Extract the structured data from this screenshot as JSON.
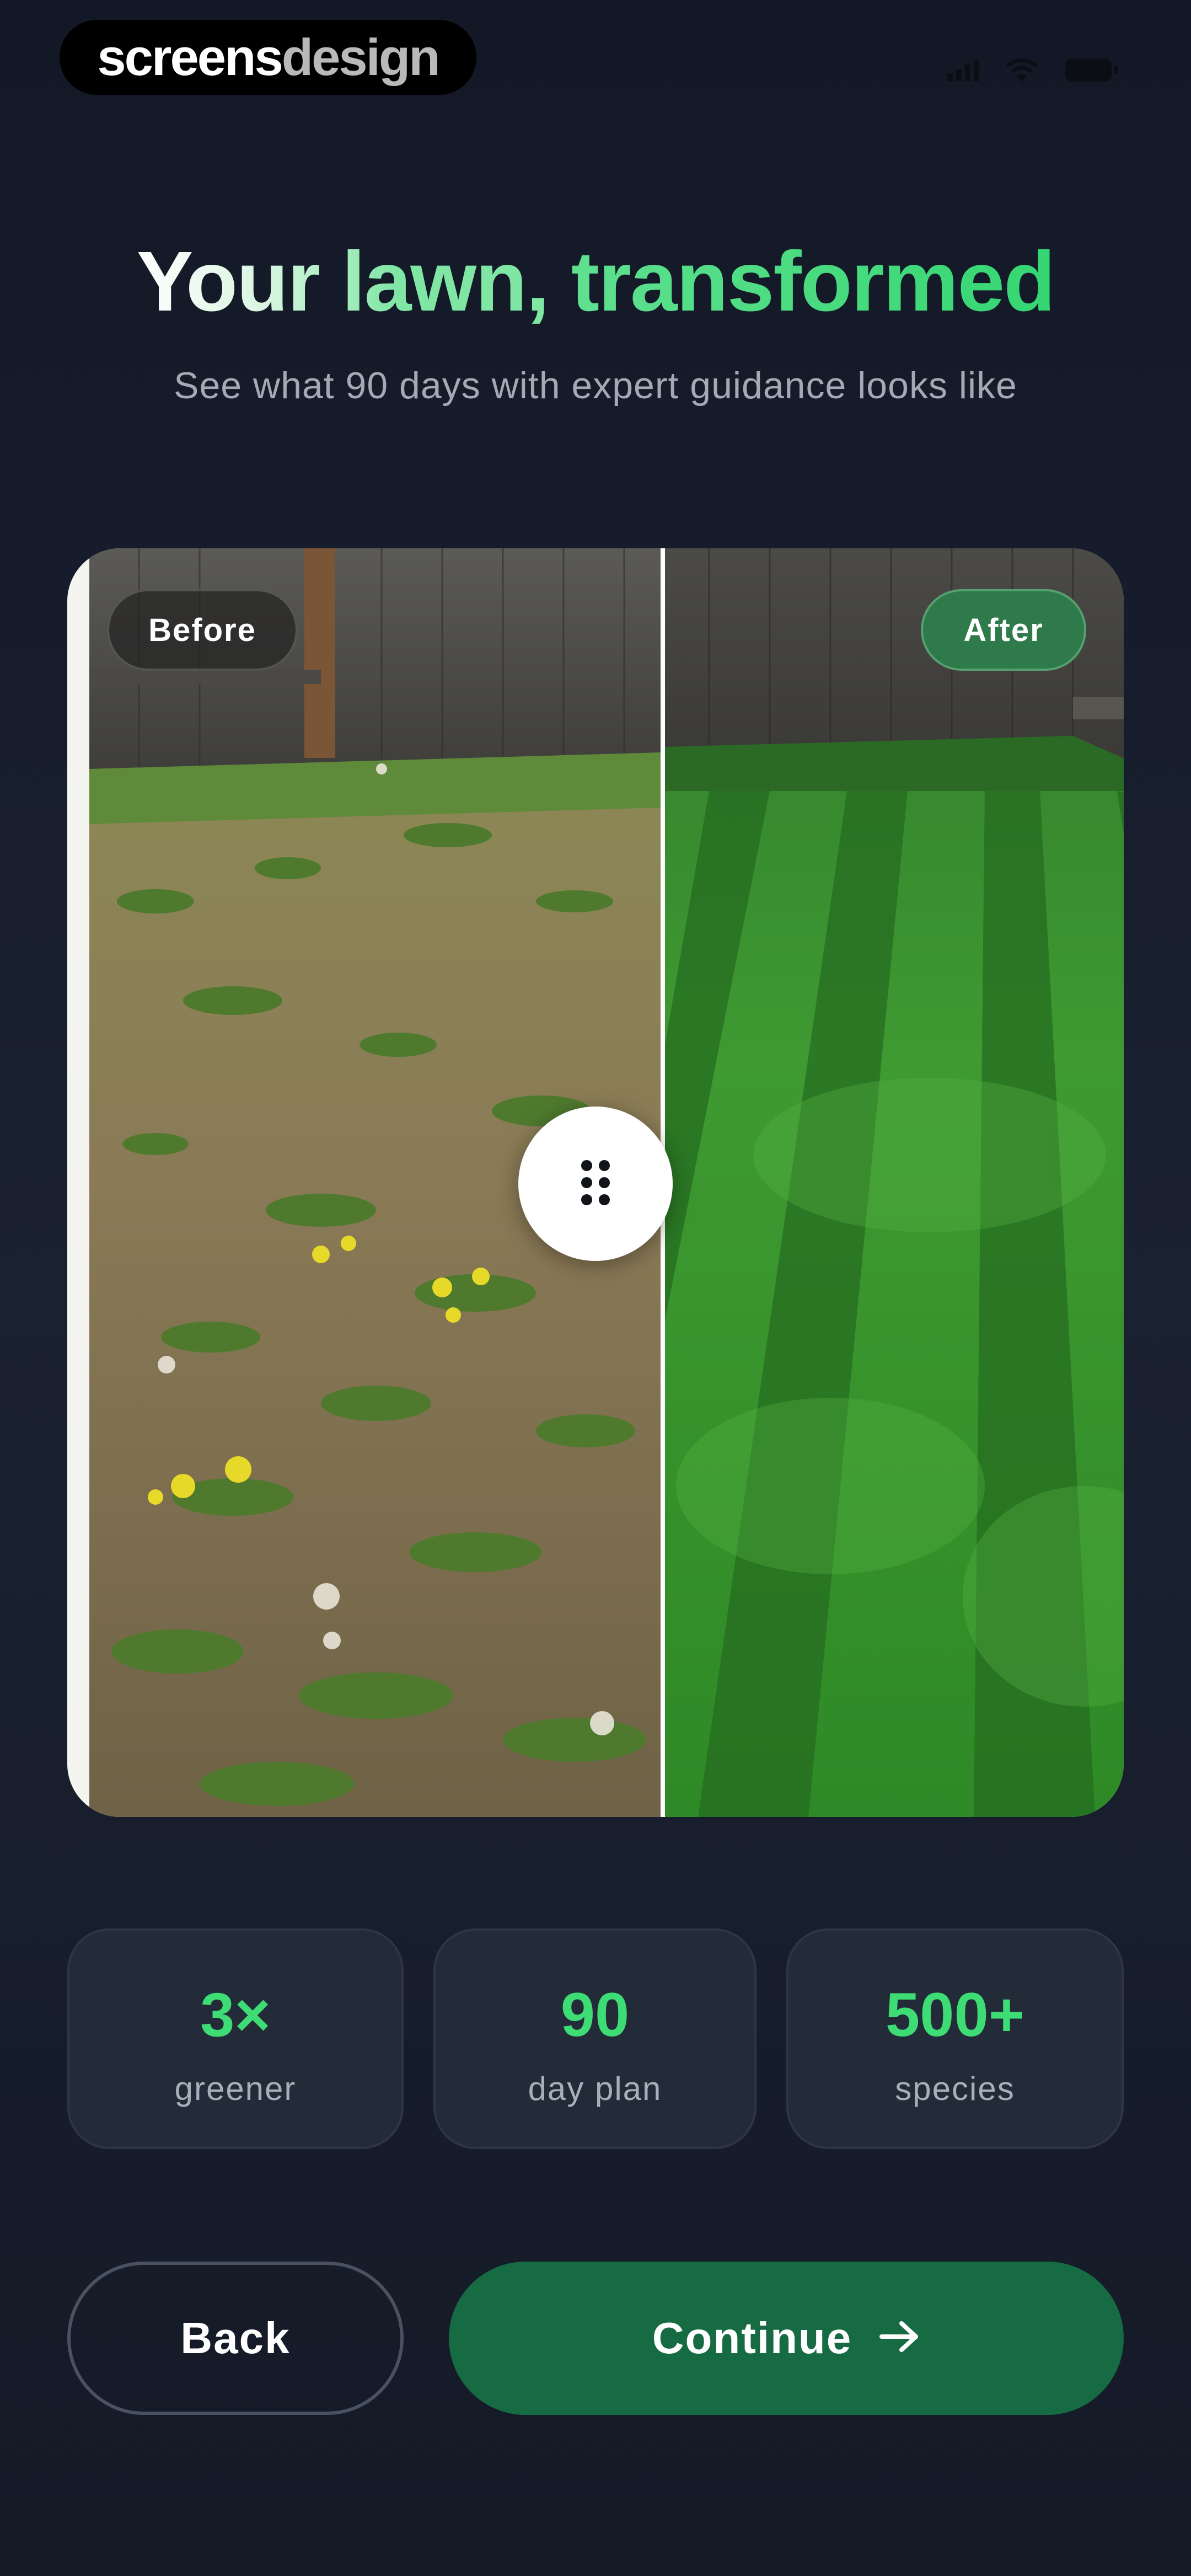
{
  "brand": {
    "part1": "screens",
    "part2": "design"
  },
  "heading": {
    "title_white": "Your lawn, ",
    "title_green": "transformed",
    "subtitle": "See what 90 days with expert guidance looks like"
  },
  "comparison": {
    "before_label": "Before",
    "after_label": "After",
    "handle_icon": "drag-handle-icon"
  },
  "stats": [
    {
      "value": "3×",
      "label": "greener"
    },
    {
      "value": "90",
      "label": "day plan"
    },
    {
      "value": "500+",
      "label": "species"
    }
  ],
  "actions": {
    "back_label": "Back",
    "continue_label": "Continue",
    "continue_icon": "arrow-right-icon"
  },
  "colors": {
    "accent": "#3ddc75",
    "button_primary": "#166b43",
    "background": "#141a26"
  }
}
